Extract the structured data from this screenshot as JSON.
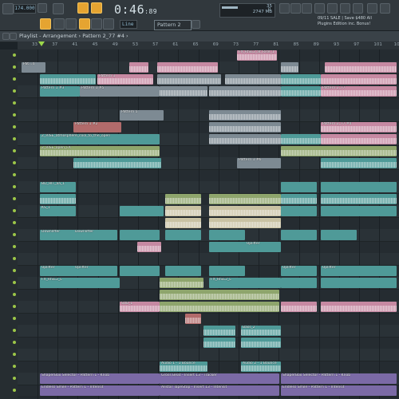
{
  "transport": {
    "tempo": "174.000",
    "time_main": "0:46",
    "time_fraction": ":89",
    "pattern": "Pattern 2",
    "cpu_value": "35",
    "memory": "2747 MB",
    "polyphony": "0"
  },
  "hint_bar": {
    "line1": "09/11  SALE | Save $480 All",
    "line2": "Plugins Edition inc. Bonus!"
  },
  "toolbar": {
    "mode_label": "Line"
  },
  "playlist": {
    "title": "Playlist - Arrangement › Pattern 2_77 #4 ›",
    "ruler_marks": [
      "33",
      "37",
      "41",
      "45",
      "49",
      "53",
      "57",
      "61",
      "65",
      "69",
      "73",
      "77",
      "81",
      "85",
      "89",
      "93",
      "97",
      "101",
      "105"
    ]
  },
  "clip_labels": {
    "c_top": "FX_RISE2_at_Rise_1",
    "c_pat_a": "Pat...4",
    "c_pat_b": "Pattern 1",
    "c_pat1": "Pattern 1 #3",
    "c_pat1b": "Pattern 1 #5",
    "c_pat5": "Pattern 5",
    "c_pat3": "Pattern 1 #2",
    "c_pat_right": "Pattern 2_77",
    "c_pat_right2": "Pattern 2_77 #4",
    "c_atmos": "Z_RISE_open_FX",
    "c_atmos2": "Z_RISE_atmosphere_cool_to_the_open",
    "c_pat6": "Pattern 1 #6",
    "c_hat": "BD_HIT_aa_1",
    "c_kick": "KS_1",
    "c_downlifter": "Downlifter",
    "c_uplifter": "Uplifter",
    "c_fx_hit": "FX_RISE2_L",
    "c_sub": "SUB_L",
    "c_bass": "Bass_2",
    "c_send1": "Audio 1 - 1 Bounce",
    "c_send2": "Audio 2 - 1 Bounce",
    "c_automation1": "ShaperBox Selector - Pattern 1 - Knob",
    "c_automation2": "Gross Beat - Insert 13 - Tracker",
    "c_automation3": "Endless Smile - Pattern 1 - Intensit",
    "c_automation4": "Allstar TapeStop - Insert 13 - Intensit"
  },
  "colors": {
    "accent_orange": "#e5a431",
    "clip_teal": "#4f9a98",
    "clip_green": "#8ea56c",
    "clip_pink": "#c689a2",
    "clip_gray": "#7d8a93",
    "clip_purple": "#7b6aa6",
    "clip_red": "#b26b6b",
    "clip_cream": "#c9c2a3",
    "playhead": "#9cd84a"
  }
}
